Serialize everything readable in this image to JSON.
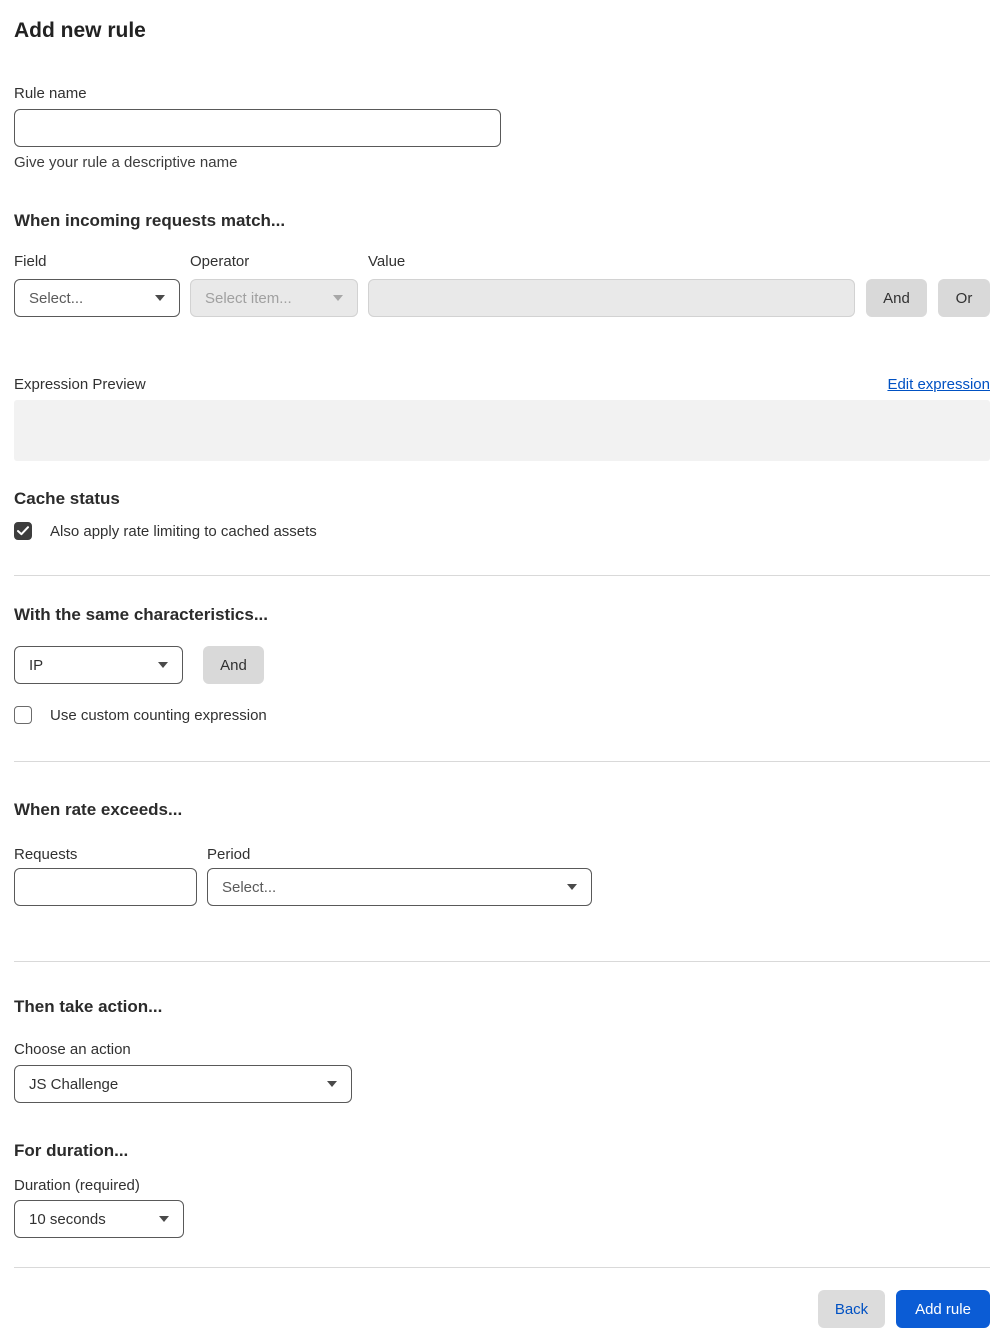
{
  "page": {
    "title": "Add new rule"
  },
  "rule_name": {
    "label": "Rule name",
    "value": "",
    "helper": "Give your rule a descriptive name"
  },
  "match_section": {
    "heading": "When incoming requests match...",
    "field": {
      "label": "Field",
      "value": "Select..."
    },
    "operator": {
      "label": "Operator",
      "value": "Select item..."
    },
    "value": {
      "label": "Value",
      "value": ""
    },
    "and_label": "And",
    "or_label": "Or"
  },
  "expression": {
    "label": "Expression Preview",
    "edit_link": "Edit expression",
    "preview": ""
  },
  "cache": {
    "heading": "Cache status",
    "checkbox_label": "Also apply rate limiting to cached assets",
    "checked": true
  },
  "characteristics": {
    "heading": "With the same characteristics...",
    "select_value": "IP",
    "and_label": "And",
    "checkbox_label": "Use custom counting expression",
    "checked": false
  },
  "rate": {
    "heading": "When rate exceeds...",
    "requests_label": "Requests",
    "requests_value": "",
    "period_label": "Period",
    "period_value": "Select..."
  },
  "action": {
    "heading": "Then take action...",
    "label": "Choose an action",
    "value": "JS Challenge"
  },
  "duration": {
    "heading": "For duration...",
    "label": "Duration (required)",
    "value": "10 seconds"
  },
  "footer": {
    "back_label": "Back",
    "submit_label": "Add rule"
  },
  "colors": {
    "primary_blue": "#0b5cd5",
    "link_blue": "#0051c3",
    "button_gray": "#d9d9d9",
    "disabled_bg": "#e9e9e9",
    "preview_bg": "#f2f2f2",
    "checkbox_checked": "#3d3d3d",
    "divider": "#d9d9d9",
    "text": "#313131"
  }
}
